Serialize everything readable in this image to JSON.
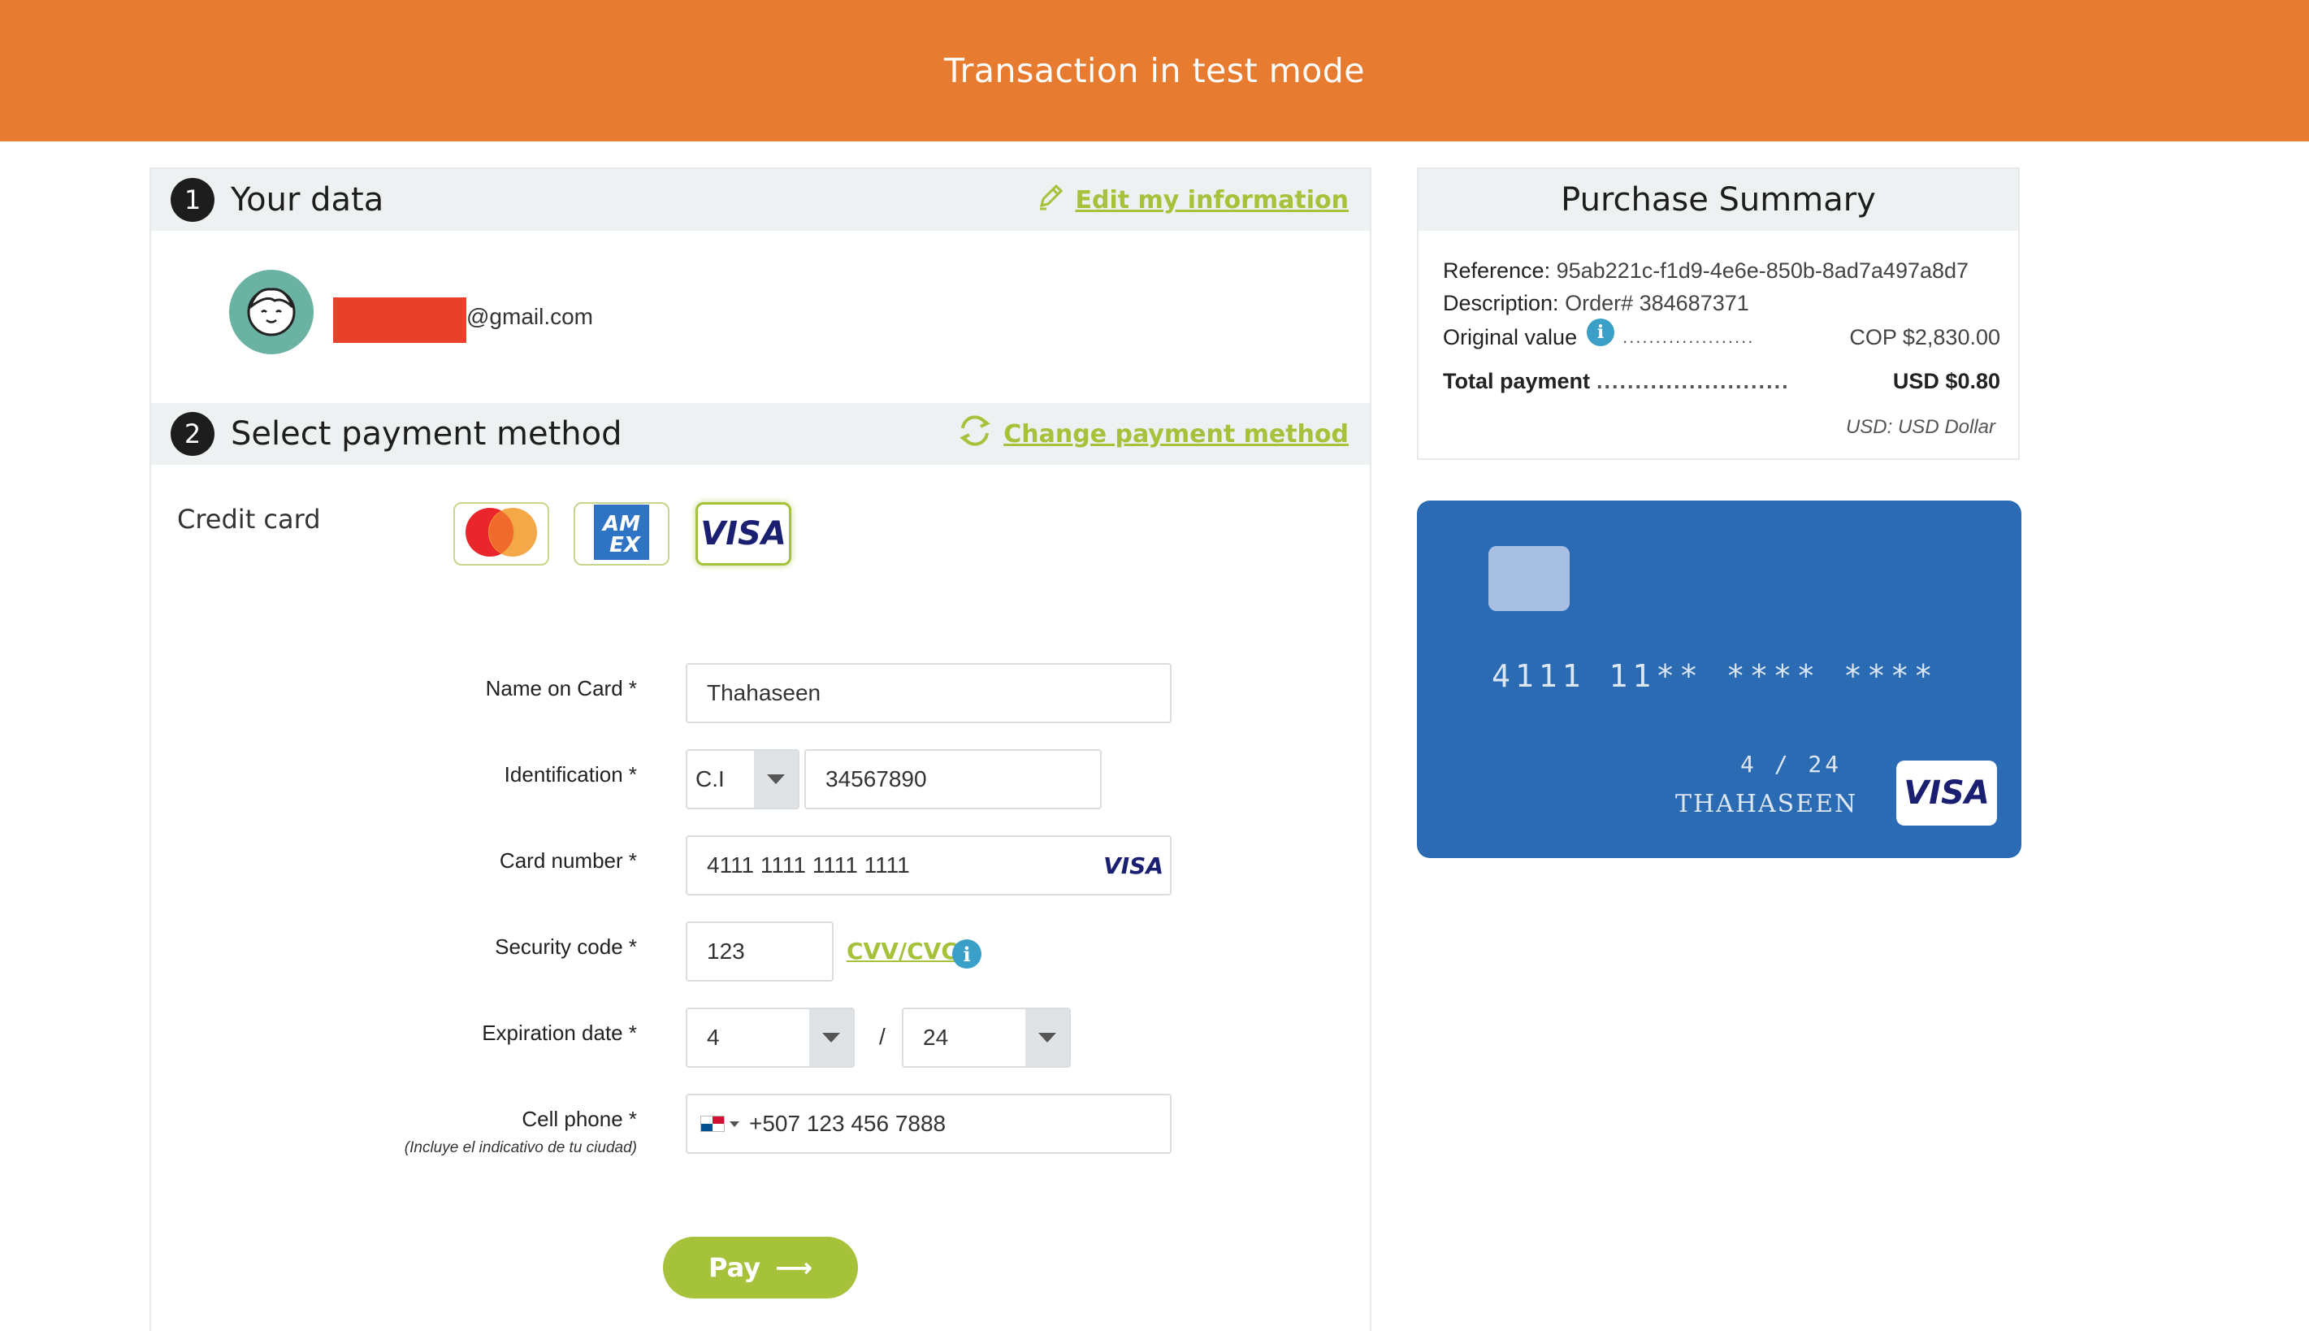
{
  "banner": {
    "text": "Transaction in test mode"
  },
  "section1": {
    "number": "1",
    "title": "Your data",
    "edit_link": "Edit my information",
    "email": "@gmail.com"
  },
  "section2": {
    "number": "2",
    "title": "Select payment method",
    "change_link": "Change payment method",
    "method_label": "Credit card",
    "brands": [
      "mastercard",
      "amex",
      "visa"
    ],
    "selected_brand": "visa"
  },
  "form": {
    "name_label": "Name on Card *",
    "name_value": "Thahaseen",
    "id_label": "Identification *",
    "id_type": "C.I",
    "id_value": "34567890",
    "card_label": "Card number *",
    "card_value": "4111 1111 1111 1111",
    "card_brand_text": "VISA",
    "cvv_label": "Security code *",
    "cvv_value": "123",
    "cvv_link": "CVV/CVC",
    "exp_label": "Expiration date *",
    "exp_month": "4",
    "exp_sep": "/",
    "exp_year": "24",
    "phone_label": "Cell phone *",
    "phone_hint": "(Incluye el indicativo de tu ciudad)",
    "phone_value": "+507 123 456 7888",
    "pay_label": "Pay",
    "pay_arrow": "⟶"
  },
  "summary": {
    "title": "Purchase Summary",
    "reference_label": "Reference:",
    "reference_value": "95ab221c-f1d9-4e6e-850b-8ad7a497a8d7",
    "description_label": "Description:",
    "description_value": "Order# 384687371",
    "original_label": "Original value",
    "original_dots": "....................",
    "original_value": "COP $2,830.00",
    "total_label": "Total payment",
    "total_dots": ".........................",
    "total_value": "USD $0.80",
    "currency_note": "USD: USD Dollar"
  },
  "card_preview": {
    "number": "4111 11** **** ****",
    "expiry": "4 / 24",
    "holder": "THAHASEEN",
    "brand": "VISA",
    "color": "#2b6bb4"
  },
  "colors": {
    "accent": "#a6c13a",
    "banner": "#e77b30",
    "redaction": "#e8402a"
  },
  "icons": [
    "pencil-icon",
    "refresh-icon",
    "info-icon",
    "avatar-face-icon",
    "flag-panama-icon",
    "chevron-down-icon",
    "arrow-right-icon"
  ]
}
